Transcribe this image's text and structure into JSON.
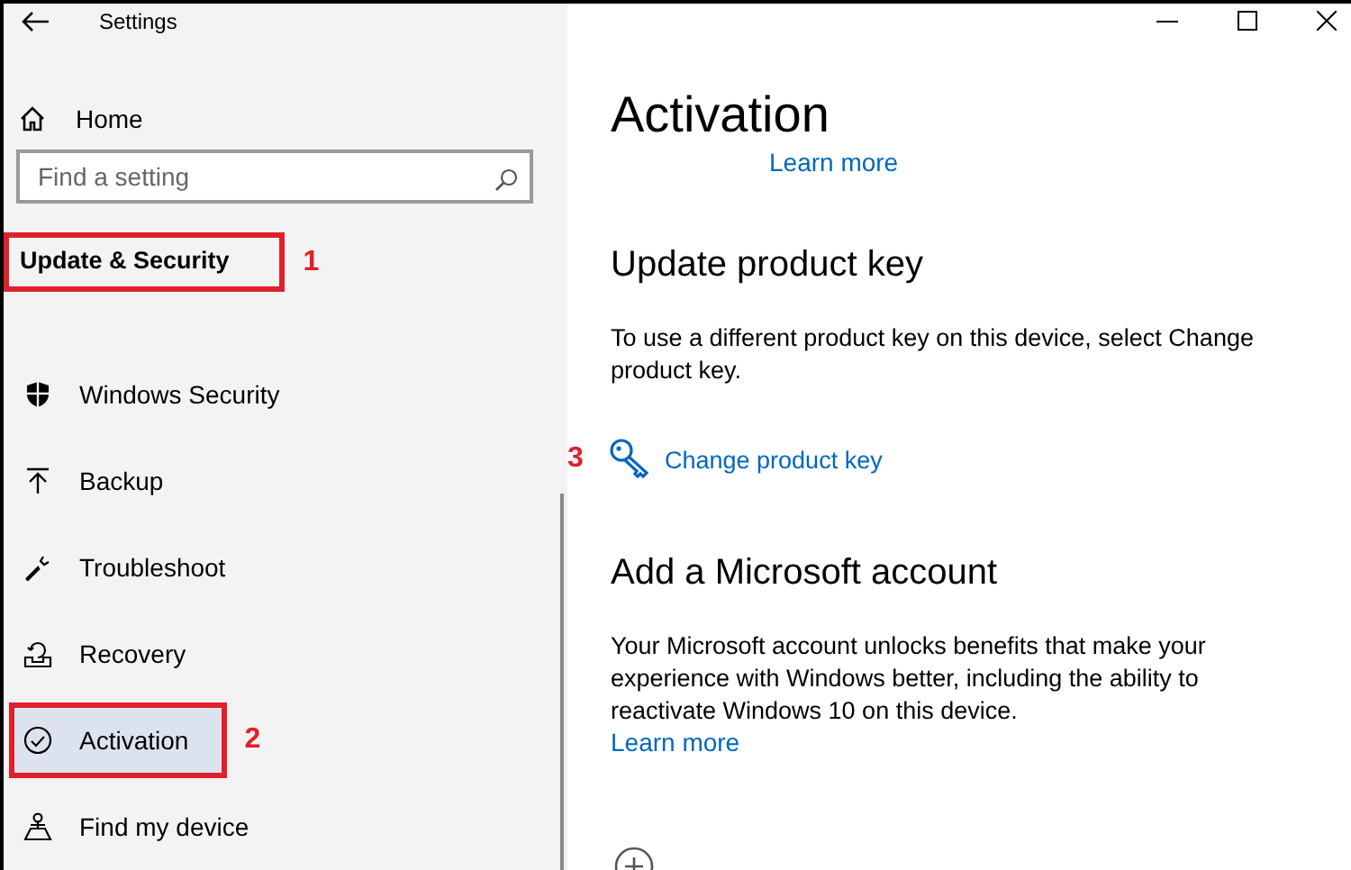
{
  "window": {
    "title": "Settings"
  },
  "sidebar": {
    "home": "Home",
    "search": {
      "placeholder": "Find a setting"
    },
    "category": {
      "label": "Update & Security",
      "annotation": "1"
    },
    "items": [
      {
        "label": "Windows Security",
        "selected": false
      },
      {
        "label": "Backup",
        "selected": false
      },
      {
        "label": "Troubleshoot",
        "selected": false
      },
      {
        "label": "Recovery",
        "selected": false
      },
      {
        "label": "Activation",
        "selected": true,
        "annotation": "2"
      },
      {
        "label": "Find my device",
        "selected": false
      }
    ]
  },
  "content": {
    "title": "Activation",
    "top_link": "Learn more",
    "sections": [
      {
        "heading": "Update product key",
        "text": "To use a different product key on this device, select Change product key.",
        "action": {
          "label": "Change product key",
          "annotation": "3"
        }
      },
      {
        "heading": "Add a Microsoft account",
        "text": "Your Microsoft account unlocks benefits that make your experience with Windows better, including the ability to reactivate Windows 10 on this device.",
        "link": "Learn more"
      }
    ]
  }
}
